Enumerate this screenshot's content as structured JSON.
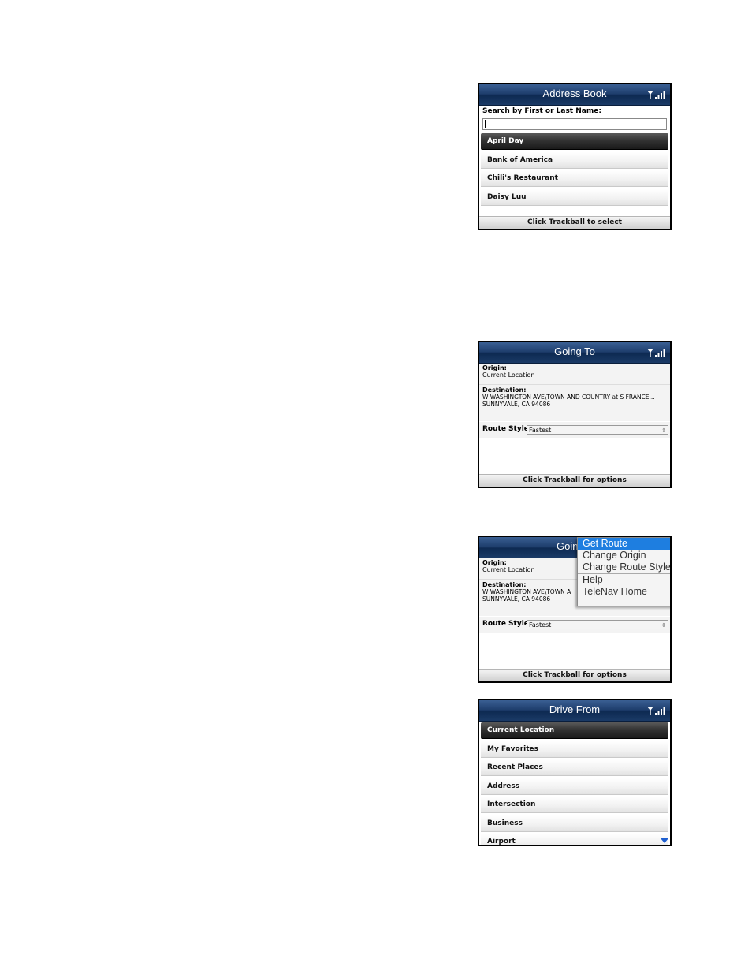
{
  "address_book": {
    "title": "Address Book",
    "search_label": "Search by First or Last Name:",
    "search_value": "",
    "items": [
      "April Day",
      "Bank of America",
      "Chili's Restaurant",
      "Daisy Luu"
    ],
    "status": "Click Trackball to select"
  },
  "going_to": {
    "title": "Going To",
    "origin_label": "Origin:",
    "origin_value": "Current Location",
    "destination_label": "Destination:",
    "destination_line1": "W WASHINGTON AVE\\TOWN AND COUNTRY at S FRANCE...",
    "destination_line2": "SUNNYVALE, CA 94086",
    "route_style_label": "Route Style:",
    "route_style_value": "Fastest",
    "status": "Click Trackball for options"
  },
  "going_to_menu": {
    "title_partial": "Goin",
    "origin_label": "Origin:",
    "origin_value": "Current Location",
    "destination_label": "Destination:",
    "destination_line1": "W WASHINGTON AVE\\TOWN A",
    "destination_line2": "SUNNYVALE, CA 94086",
    "route_style_label": "Route Style:",
    "route_style_value": "Fastest",
    "status": "Click Trackball for options",
    "menu_items": [
      "Get Route",
      "Change Origin",
      "Change Route Style",
      "Help",
      "TeleNav Home"
    ]
  },
  "drive_from": {
    "title": "Drive From",
    "items": [
      "Current Location",
      "My Favorites",
      "Recent Places",
      "Address",
      "Intersection",
      "Business",
      "Airport"
    ]
  },
  "colors": {
    "titlebar": "#1f3f6e",
    "selected": "#1a1a1a",
    "menu_highlight": "#1e7ee0",
    "scroll_arrow": "#1e5fd0"
  }
}
